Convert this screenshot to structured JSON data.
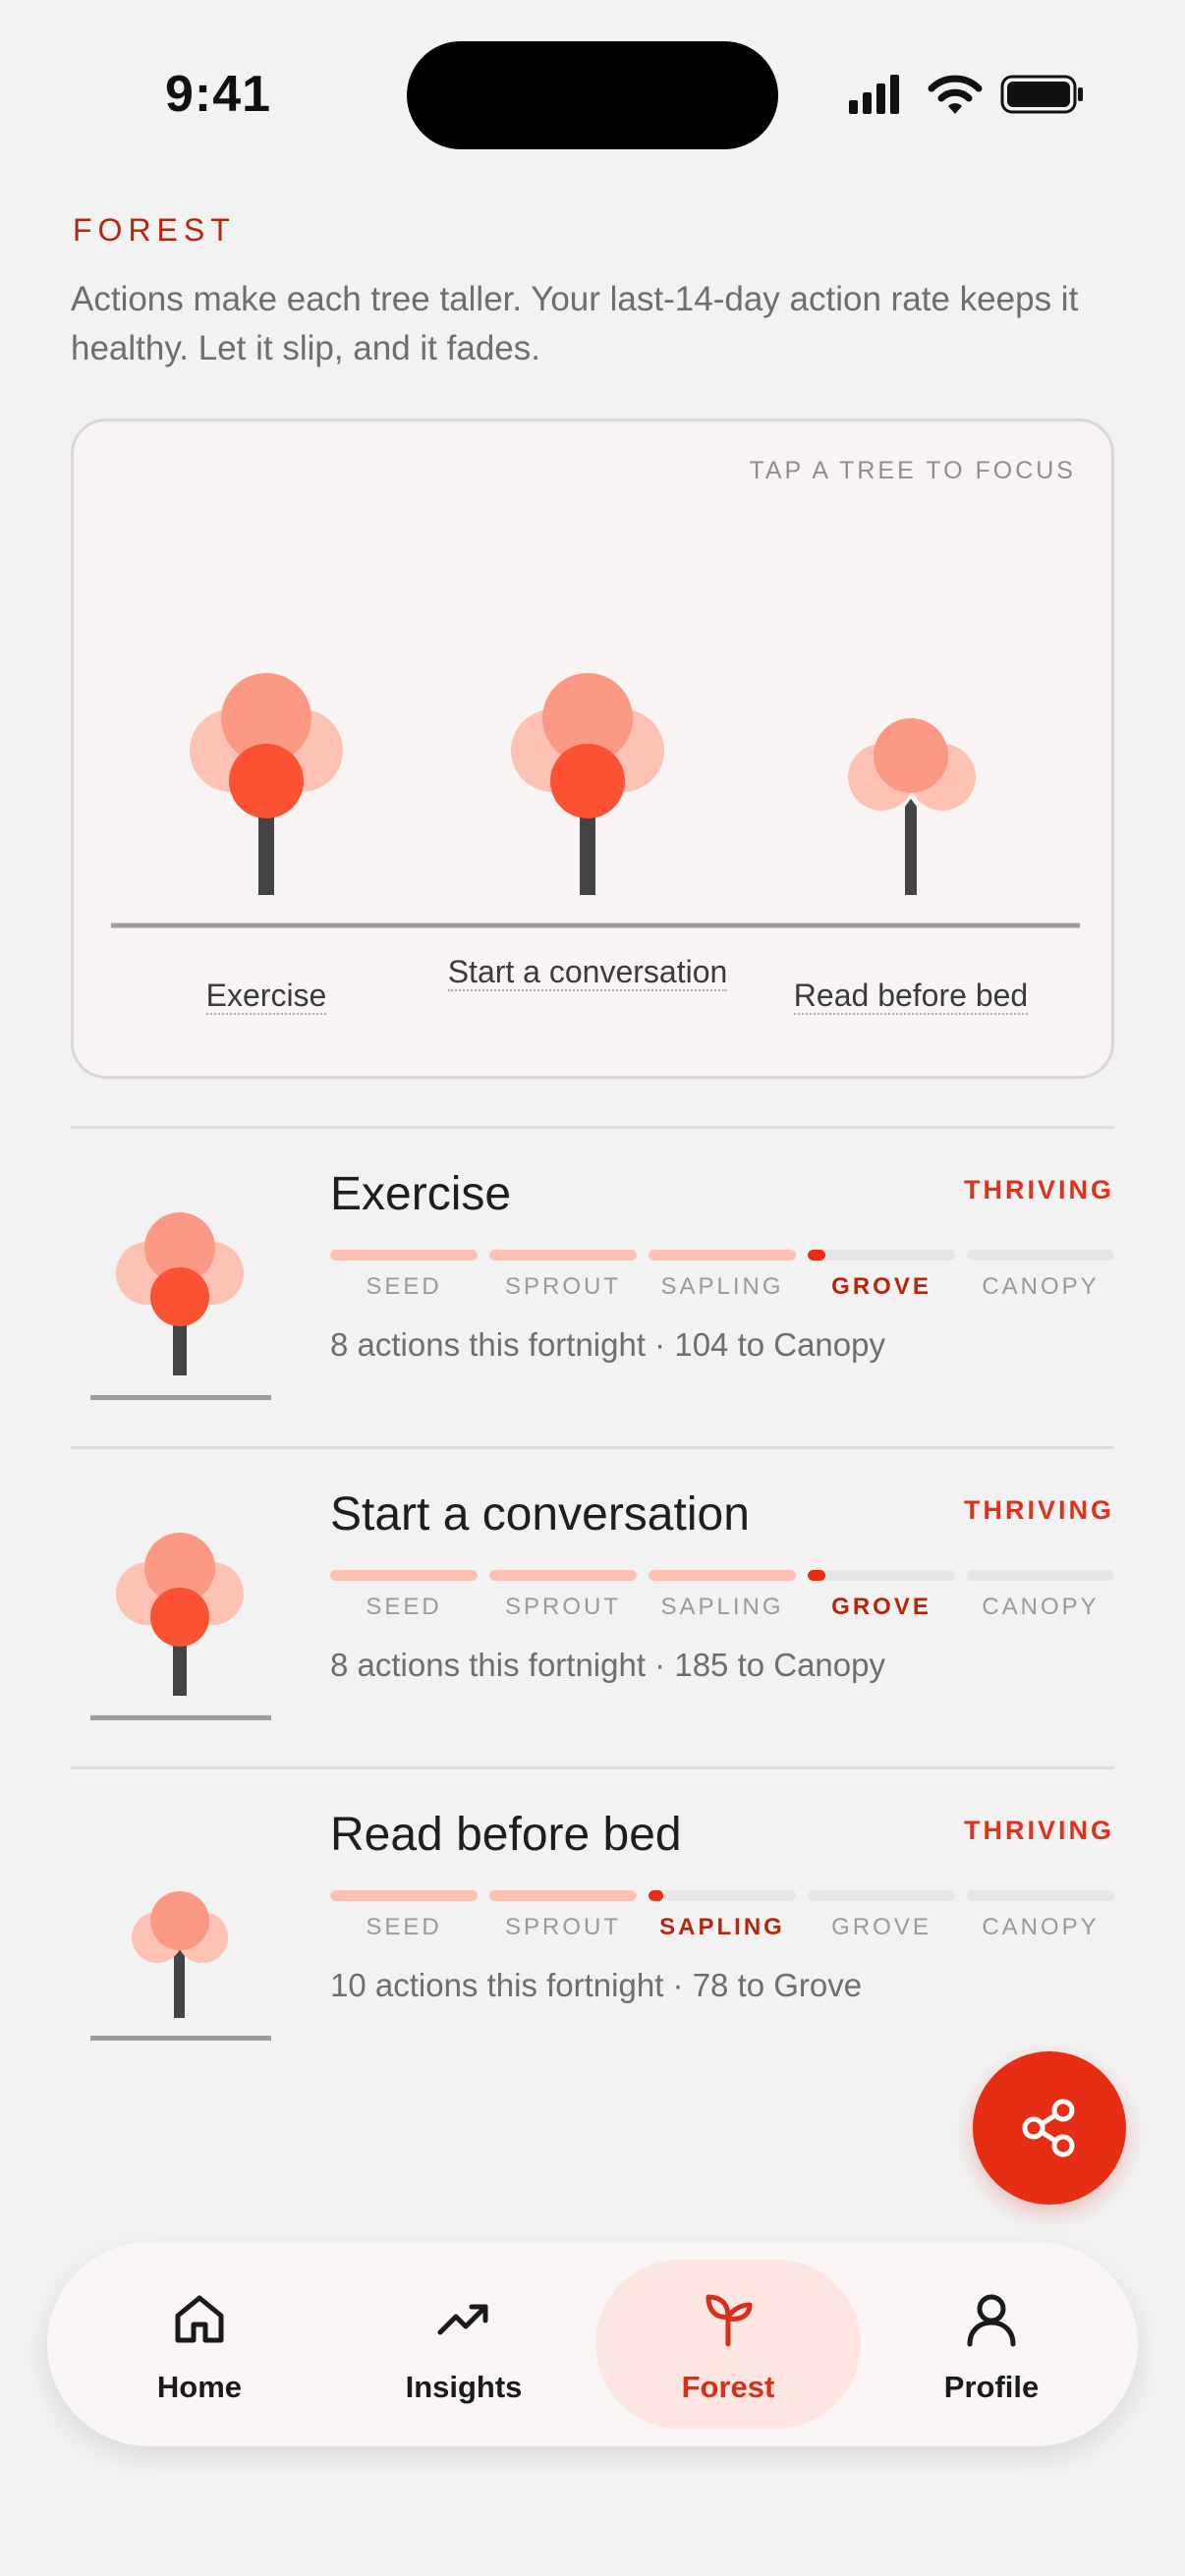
{
  "status_bar": {
    "time": "9:41"
  },
  "header": {
    "label": "FOREST",
    "description": "Actions make each tree taller. Your last-14-day action rate keeps it healthy. Let it slip, and it fades."
  },
  "forest_card": {
    "hint": "TAP A TREE TO FOCUS",
    "trees": [
      {
        "label": "Exercise"
      },
      {
        "label": "Start a conversation"
      },
      {
        "label": "Read before bed"
      }
    ]
  },
  "stages": [
    "SEED",
    "SPROUT",
    "SAPLING",
    "GROVE",
    "CANOPY"
  ],
  "habits": [
    {
      "name": "Exercise",
      "status": "THRIVING",
      "stage_index": 3,
      "stage_progress": 0.12,
      "progress_text": "8 actions this fortnight · 104 to Canopy"
    },
    {
      "name": "Start a conversation",
      "status": "THRIVING",
      "stage_index": 3,
      "stage_progress": 0.12,
      "progress_text": "8 actions this fortnight · 185 to Canopy"
    },
    {
      "name": "Read before bed",
      "status": "THRIVING",
      "stage_index": 2,
      "stage_progress": 0.1,
      "progress_text": "10 actions this fortnight · 78 to Grove"
    }
  ],
  "fab": {
    "icon": "share-icon"
  },
  "nav": {
    "items": [
      {
        "label": "Home",
        "icon": "home-icon"
      },
      {
        "label": "Insights",
        "icon": "trending-up-icon"
      },
      {
        "label": "Forest",
        "icon": "sprout-icon",
        "active": true
      },
      {
        "label": "Profile",
        "icon": "user-icon"
      }
    ]
  },
  "colors": {
    "accent": "#e62e14",
    "accent_dark": "#b5260f",
    "stage_done": "#fcc1b2",
    "canopy_light": "#fdc2b3",
    "canopy_mid": "#fb9985",
    "canopy_core": "#fb5233",
    "trunk": "#444444"
  }
}
